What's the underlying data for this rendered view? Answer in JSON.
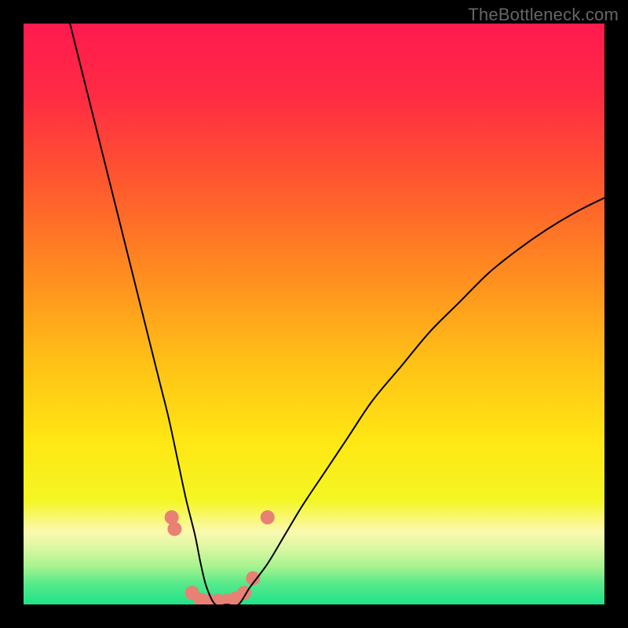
{
  "watermark": "TheBottleneck.com",
  "chart_data": {
    "type": "line",
    "title": "",
    "xlabel": "",
    "ylabel": "",
    "xlim": [
      0,
      100
    ],
    "ylim": [
      0,
      100
    ],
    "background_gradient": {
      "stops": [
        {
          "offset": 0.0,
          "color": "#ff1a4f"
        },
        {
          "offset": 0.12,
          "color": "#ff2a44"
        },
        {
          "offset": 0.28,
          "color": "#ff5a2e"
        },
        {
          "offset": 0.44,
          "color": "#ff8f1f"
        },
        {
          "offset": 0.58,
          "color": "#ffc016"
        },
        {
          "offset": 0.72,
          "color": "#ffe714"
        },
        {
          "offset": 0.82,
          "color": "#f4f623"
        },
        {
          "offset": 0.875,
          "color": "#fbf9b0"
        },
        {
          "offset": 0.905,
          "color": "#d8f7a0"
        },
        {
          "offset": 0.935,
          "color": "#a6f38f"
        },
        {
          "offset": 0.965,
          "color": "#55e98a"
        },
        {
          "offset": 1.0,
          "color": "#1fe389"
        }
      ]
    },
    "series": [
      {
        "name": "bottleneck-curve",
        "color": "#000000",
        "stroke_width": 2,
        "x": [
          8,
          10,
          12,
          14,
          16,
          18,
          20,
          22,
          23.5,
          25,
          26.5,
          28,
          29.5,
          30.5,
          31.5,
          33,
          35,
          37,
          39,
          42,
          45,
          48,
          52,
          56,
          60,
          65,
          70,
          75,
          80,
          85,
          90,
          95,
          100
        ],
        "y": [
          100,
          92,
          84,
          76,
          68,
          60,
          52,
          44,
          38,
          32,
          25,
          18,
          12,
          7,
          3,
          0,
          0,
          0,
          3,
          7,
          12,
          17,
          23,
          29,
          35,
          41,
          47,
          52,
          57,
          61,
          64.5,
          67.5,
          70
        ]
      }
    ],
    "markers": {
      "name": "highlight-dots",
      "color": "#e98074",
      "radius": 9,
      "points": [
        {
          "x": 25.5,
          "y": 15
        },
        {
          "x": 26.0,
          "y": 13
        },
        {
          "x": 29.0,
          "y": 2
        },
        {
          "x": 30.5,
          "y": 0.8
        },
        {
          "x": 32.0,
          "y": 0.6
        },
        {
          "x": 33.5,
          "y": 0.6
        },
        {
          "x": 35.0,
          "y": 0.6
        },
        {
          "x": 36.5,
          "y": 1.0
        },
        {
          "x": 38.0,
          "y": 2.0
        },
        {
          "x": 39.5,
          "y": 4.5
        },
        {
          "x": 42.0,
          "y": 15
        }
      ]
    }
  }
}
